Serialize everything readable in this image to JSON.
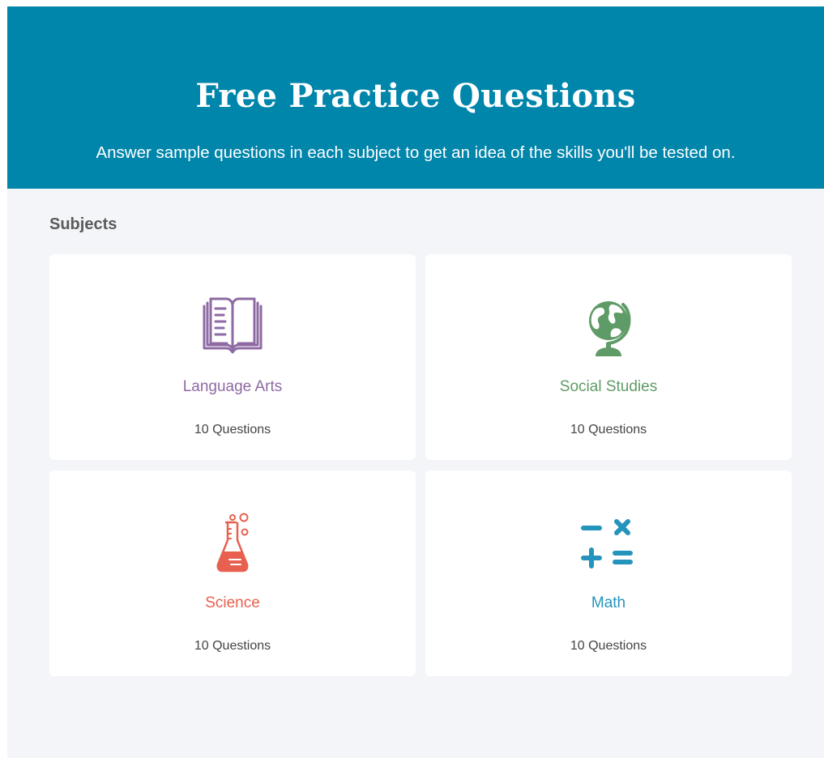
{
  "hero": {
    "title": "Free Practice Questions",
    "subtitle": "Answer sample questions in each subject to get an idea of the skills you'll be tested on.",
    "background_color": "#0085ab"
  },
  "subjects": {
    "label": "Subjects",
    "items": [
      {
        "name": "Language Arts",
        "count": "10 Questions",
        "icon": "open-book-icon",
        "color": "#8e6aa3"
      },
      {
        "name": "Social Studies",
        "count": "10 Questions",
        "icon": "globe-icon",
        "color": "#5f9b66"
      },
      {
        "name": "Science",
        "count": "10 Questions",
        "icon": "flask-icon",
        "color": "#e8604f"
      },
      {
        "name": "Math",
        "count": "10 Questions",
        "icon": "math-symbols-icon",
        "color": "#2494bd"
      }
    ]
  }
}
